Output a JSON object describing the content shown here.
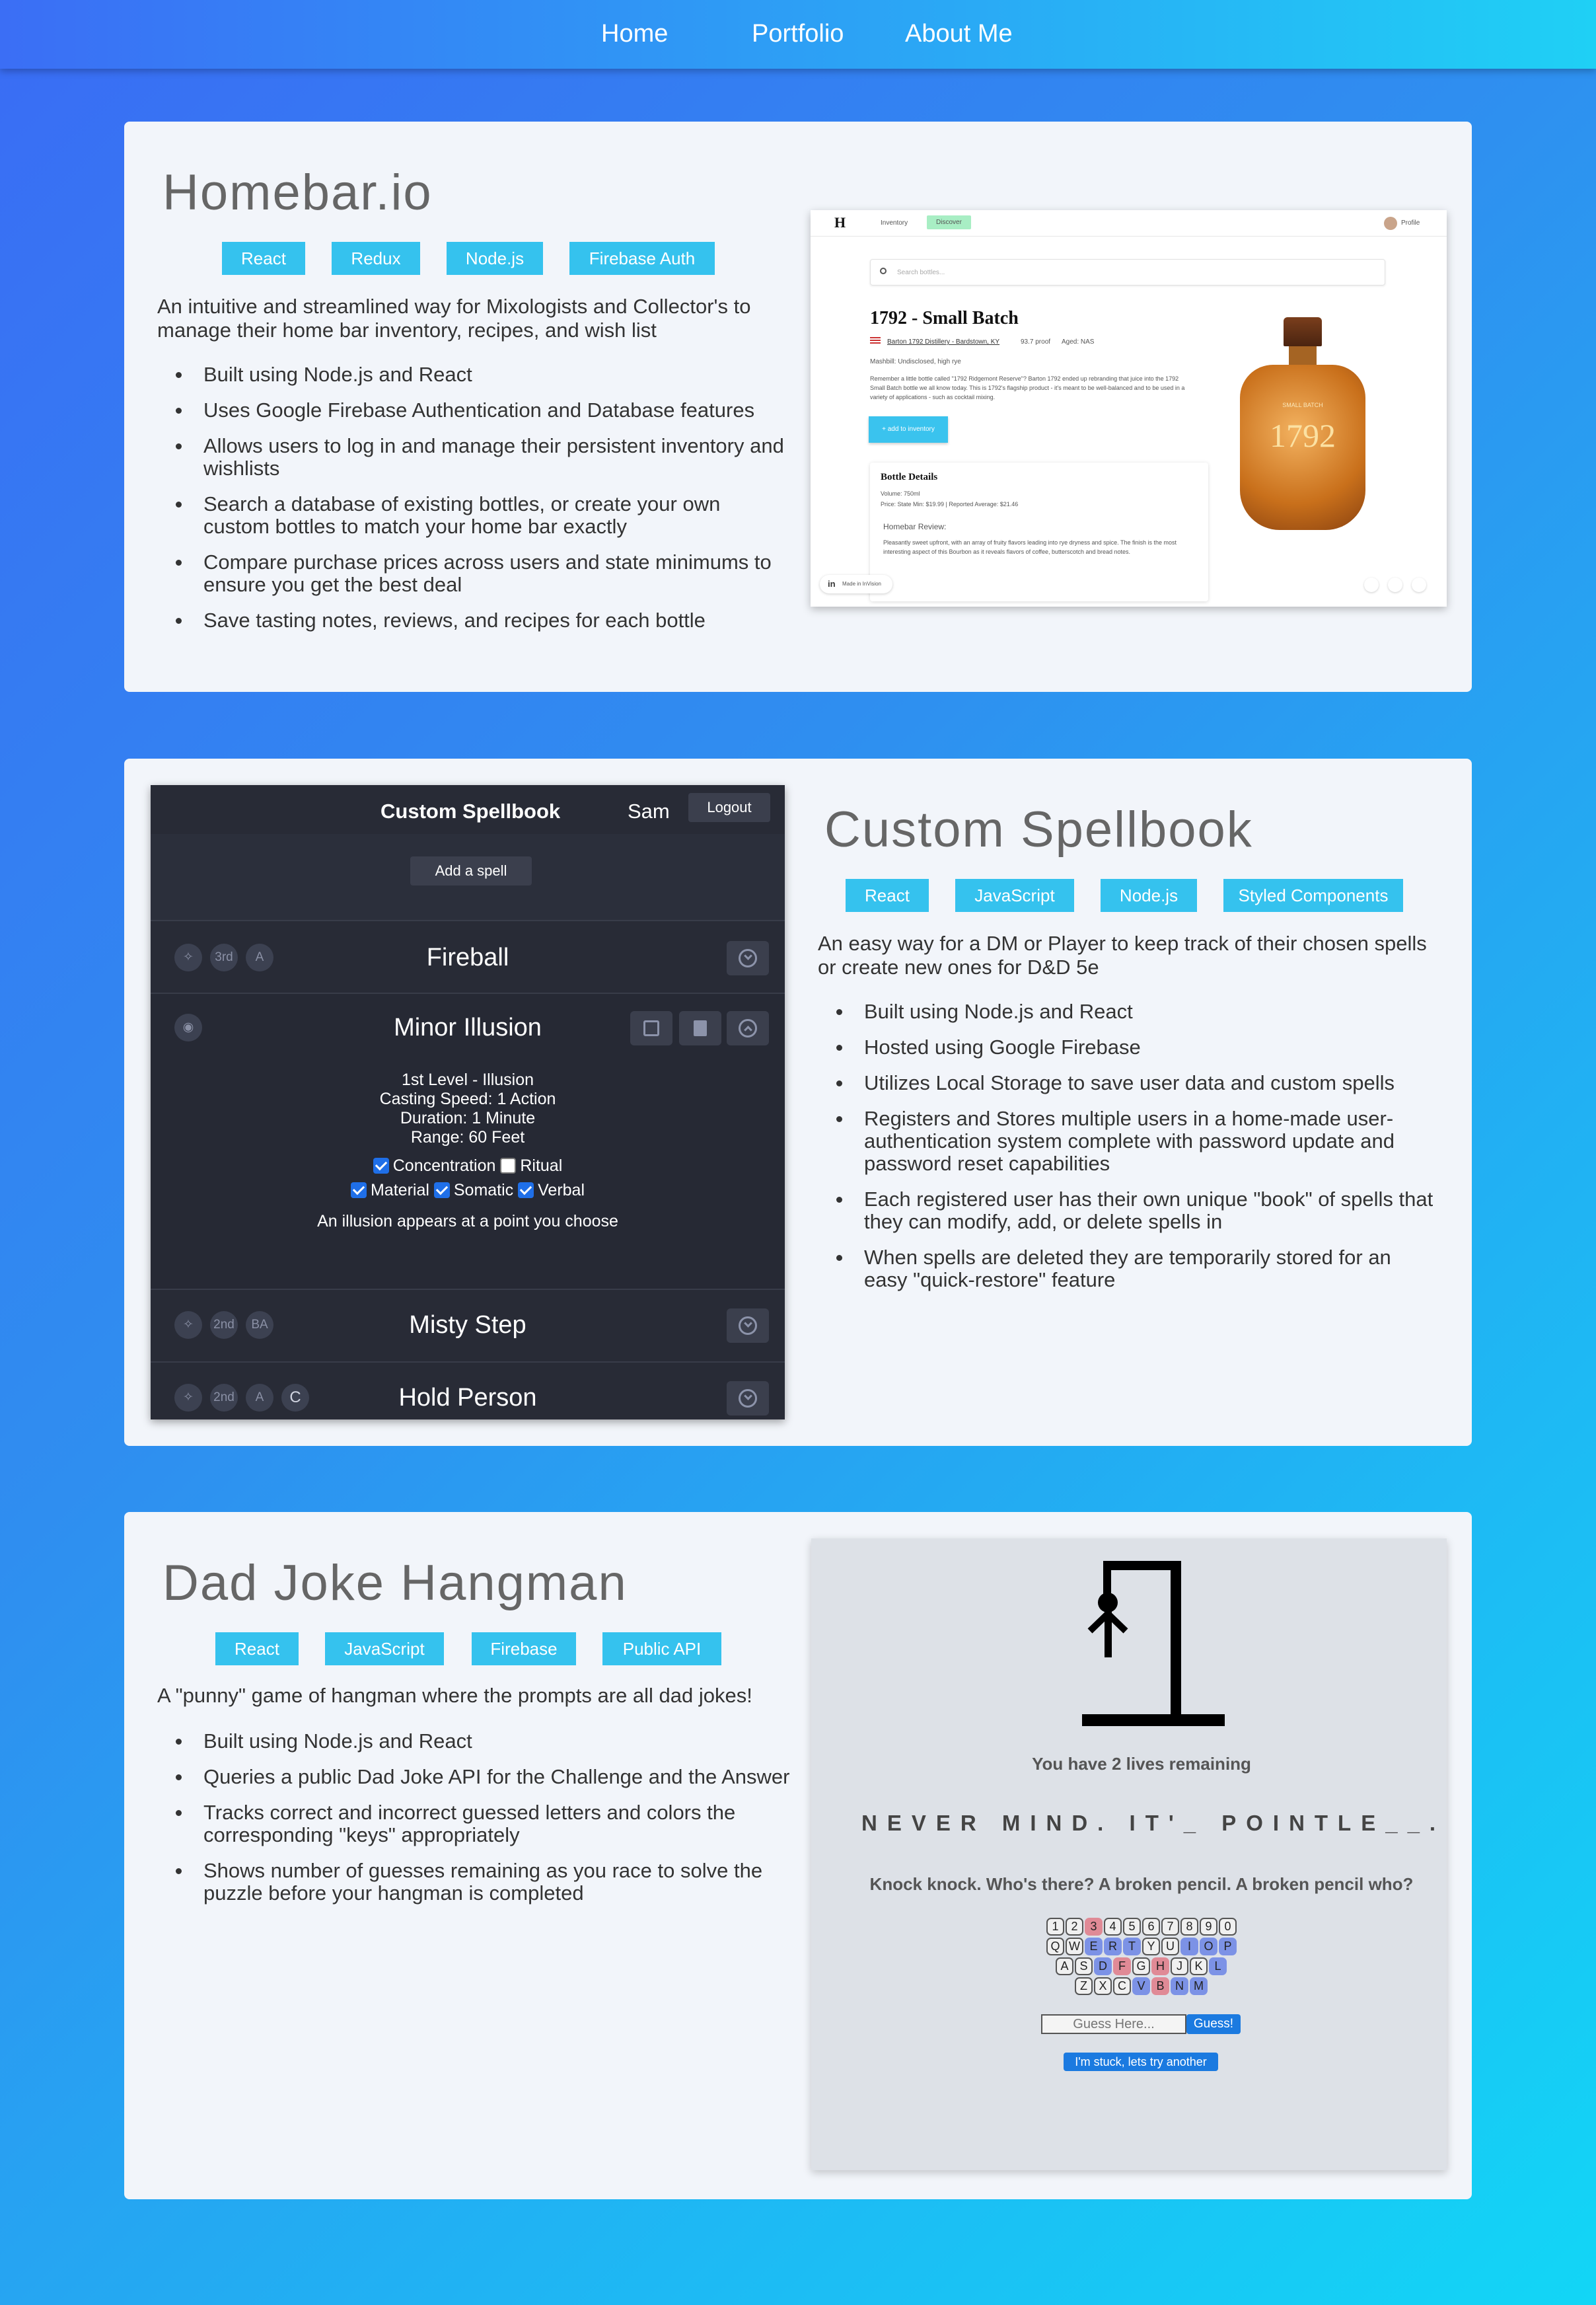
{
  "nav": {
    "home": "Home",
    "portfolio": "Portfolio",
    "about": "About Me"
  },
  "homebar": {
    "title": "Homebar.io",
    "tags": [
      "React",
      "Redux",
      "Node.js",
      "Firebase Auth"
    ],
    "description": "An intuitive and streamlined way for Mixologists and Collector's to manage their home bar inventory, recipes, and wish list",
    "features": [
      "Built using Node.js and React",
      "Uses Google Firebase Authentication and Database features",
      "Allows users to log in and manage their persistent inventory and wishlists",
      "Search a database of existing bottles, or create your own custom bottles to match your home bar exactly",
      "Compare purchase prices across users and state minimums to ensure you get the best deal",
      "Save tasting notes, reviews, and recipes for each bottle"
    ],
    "screenshot": {
      "logo": "H",
      "tab_inventory": "Inventory",
      "tab_discover": "Discover",
      "profile": "Profile",
      "search_placeholder": "Search bottles...",
      "bottle_name": "1792 - Small Batch",
      "distillery": "Barton 1792 Distillery - Bardstown, KY",
      "proof": "93.7 proof",
      "aged": "Aged: NAS",
      "mashbill": "Mashbill: Undisclosed, high rye",
      "about": "Remember a little bottle called \"1792 Ridgemont Reserve\"? Barton 1792 ended up rebranding that juice into the 1792 Small Batch bottle we all know today. This is 1792's flagship product - it's meant to be well-balanced and to be used in a variety of applications - such as cocktail mixing.",
      "add_button": "+ add to inventory",
      "details_title": "Bottle Details",
      "volume": "Volume: 750ml",
      "price": "Price: State Min: $19.99 | Reported Average: $21.46",
      "review_title": "Homebar Review:",
      "review": "Pleasantly sweet upfront, with an array of fruity flavors leading into rye dryness and spice. The finish is the most interesting aspect of this Bourbon as it reveals flavors of coffee, butterscotch and bread notes.",
      "label_top": "SMALL BATCH",
      "label_num": "1792",
      "made_in": "Made in InVision"
    }
  },
  "spellbook": {
    "title": "Custom Spellbook",
    "tags": [
      "React",
      "JavaScript",
      "Node.js",
      "Styled Components"
    ],
    "description": "An easy way for a DM or Player to keep track of their chosen spells or create new ones for D&D 5e",
    "features": [
      "Built using Node.js and React",
      "Hosted using Google Firebase",
      "Utilizes Local Storage to save user data and custom spells",
      "Registers and Stores multiple users in a home-made user-authentication system complete with password update and password reset capabilities",
      "Each registered user has their own unique \"book\" of spells that they can modify, add, or delete spells in",
      "When spells are deleted they are temporarily stored for an easy \"quick-restore\" feature"
    ],
    "app": {
      "header": "Custom Spellbook",
      "user": "Sam",
      "logout": "Logout",
      "add": "Add a spell",
      "spells": [
        {
          "name": "Fireball",
          "level": "3rd",
          "cast": "A"
        },
        {
          "name": "Minor Illusion"
        },
        {
          "name": "Misty Step",
          "level": "2nd",
          "cast": "BA"
        },
        {
          "name": "Hold Person",
          "level": "2nd",
          "cast": "A",
          "conc": "C"
        }
      ],
      "detail": {
        "level": "1st Level - Illusion",
        "speed": "Casting Speed: 1 Action",
        "duration": "Duration: 1 Minute",
        "range": "Range: 60 Feet",
        "concentration": "Concentration",
        "ritual": "Ritual",
        "material": "Material",
        "somatic": "Somatic",
        "verbal": "Verbal",
        "text": "An illusion appears at a point you choose"
      }
    }
  },
  "hangman": {
    "title": "Dad Joke Hangman",
    "tags": [
      "React",
      "JavaScript",
      "Firebase",
      "Public API"
    ],
    "description": "A \"punny\" game of hangman where the prompts are all dad jokes!",
    "features": [
      "Built using Node.js and React",
      "Queries a public Dad Joke API for the Challenge and the Answer",
      "Tracks correct and incorrect guessed letters and colors the corresponding \"keys\" appropriately",
      "Shows number of guesses remaining as you race to solve the puzzle before your hangman is completed"
    ],
    "game": {
      "lives": "You have 2 lives remaining",
      "puzzle": "NEVER MIND. IT'_ POINTLE__.",
      "joke": "Knock knock. Who's there? A broken pencil. A broken pencil who?",
      "guess_placeholder": "Guess Here...",
      "guess_button": "Guess!",
      "stuck_button": "I'm stuck, lets try another",
      "keys": [
        [
          "1",
          "2",
          "3",
          "4",
          "5",
          "6",
          "7",
          "8",
          "9",
          "0"
        ],
        [
          "Q",
          "W",
          "E",
          "R",
          "T",
          "Y",
          "U",
          "I",
          "O",
          "P"
        ],
        [
          "A",
          "S",
          "D",
          "F",
          "G",
          "H",
          "J",
          "K",
          "L"
        ],
        [
          "Z",
          "X",
          "C",
          "V",
          "B",
          "N",
          "M"
        ]
      ]
    }
  }
}
